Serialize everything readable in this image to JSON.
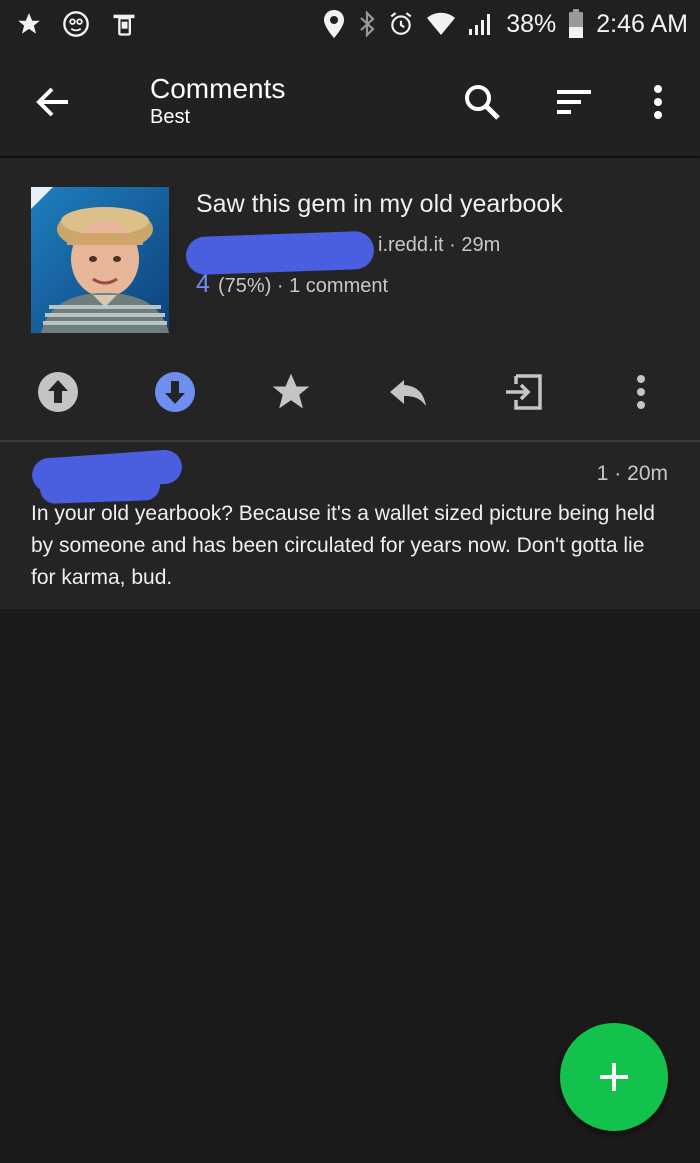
{
  "status_bar": {
    "battery": "38%",
    "time": "2:46 AM",
    "icons_left": [
      "star-icon",
      "stethoscope-icon",
      "phone-sync-icon"
    ],
    "icons_right": [
      "location-pin-icon",
      "bluetooth-icon",
      "alarm-icon",
      "wifi-icon",
      "signal-icon",
      "battery-icon"
    ]
  },
  "toolbar": {
    "title": "Comments",
    "subtitle": "Best",
    "icons": [
      "back-arrow-icon",
      "search-icon",
      "sort-icon",
      "more-vert-icon"
    ]
  },
  "post": {
    "title": "Saw this gem in my old yearbook",
    "domain_time": "i.redd.it · 29m",
    "score": "4",
    "meta": "(75%) · 1 comment"
  },
  "post_actions": [
    "upvote-icon",
    "downvote-icon",
    "save-star-icon",
    "reply-icon",
    "open-external-icon",
    "more-vert-icon"
  ],
  "comment": {
    "meta": "1 · 20m",
    "body": "In your old yearbook? Because it's a wallet sized picture being held by someone and has been circulated for years now. Don't gotta lie for karma, bud."
  },
  "colors": {
    "accent_blue": "#6f8ff0",
    "fab_green": "#12c24d",
    "redaction": "#4a5fe0",
    "background": "#1b1b1b"
  }
}
